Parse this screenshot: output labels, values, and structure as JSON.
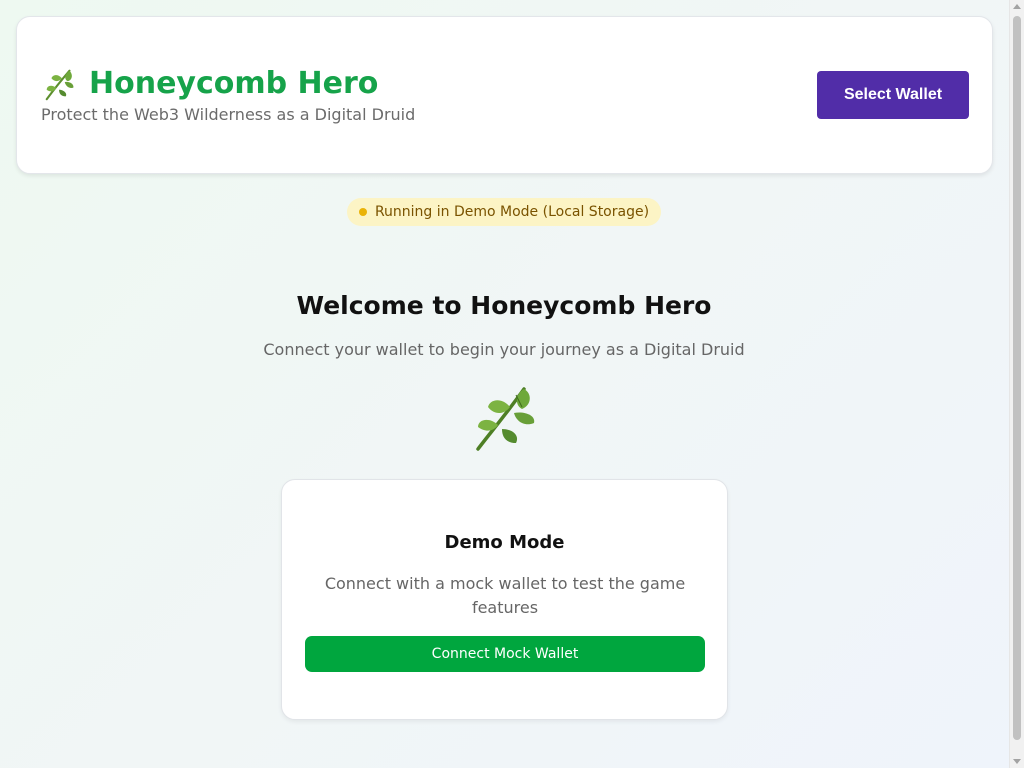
{
  "header": {
    "title": "Honeycomb Hero",
    "subtitle": "Protect the Web3 Wilderness as a Digital Druid",
    "icon": "herb-icon",
    "select_wallet_label": "Select Wallet"
  },
  "status": {
    "badge_text": "Running in Demo Mode (Local Storage)"
  },
  "welcome": {
    "title": "Welcome to Honeycomb Hero",
    "subtitle": "Connect your wallet to begin your journey as a Digital Druid",
    "icon": "herb-icon"
  },
  "demo_card": {
    "title": "Demo Mode",
    "description": "Connect with a mock wallet to test the game features",
    "button_label": "Connect Mock Wallet"
  },
  "colors": {
    "brand_green": "#16a34a",
    "wallet_button": "#512da8",
    "connect_button": "#00a63e",
    "badge_bg": "#fcf4c5"
  }
}
